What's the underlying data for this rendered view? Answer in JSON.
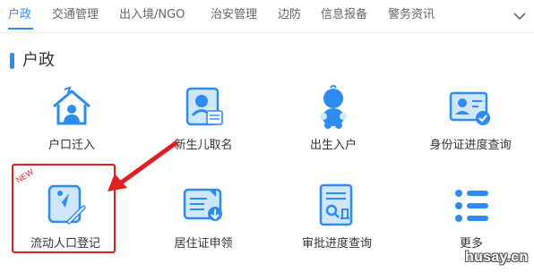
{
  "tabs": [
    {
      "label": "户政",
      "active": true
    },
    {
      "label": "交通管理",
      "active": false
    },
    {
      "label": "出入境/NGO",
      "active": false
    },
    {
      "label": "治安管理",
      "active": false
    },
    {
      "label": "边防",
      "active": false
    },
    {
      "label": "信息报备",
      "active": false
    },
    {
      "label": "警务资讯",
      "active": false
    }
  ],
  "section": {
    "title": "户政"
  },
  "items": [
    {
      "label": "户口迁入",
      "icon": "house-person-icon"
    },
    {
      "label": "新生儿取名",
      "icon": "baby-name-card-icon"
    },
    {
      "label": "出生入户",
      "icon": "baby-icon"
    },
    {
      "label": "身份证进度查询",
      "icon": "id-card-check-icon"
    },
    {
      "label": "流动人口登记",
      "icon": "floating-population-register-icon",
      "badge": "NEW"
    },
    {
      "label": "居住证申领",
      "icon": "residence-permit-icon"
    },
    {
      "label": "审批进度查询",
      "icon": "approval-search-icon"
    },
    {
      "label": "更多",
      "icon": "more-list-icon"
    }
  ],
  "colors": {
    "accent": "#2d8cf0",
    "highlight": "#e02020",
    "icon_primary": "#2d8cf0",
    "icon_light": "#cfe6fb"
  },
  "watermark": "husay.cn"
}
